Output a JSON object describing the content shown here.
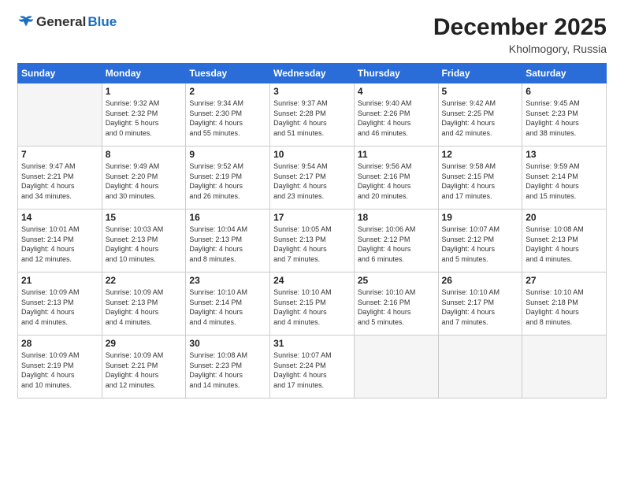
{
  "logo": {
    "general": "General",
    "blue": "Blue"
  },
  "header": {
    "month": "December 2025",
    "location": "Kholmogory, Russia"
  },
  "weekdays": [
    "Sunday",
    "Monday",
    "Tuesday",
    "Wednesday",
    "Thursday",
    "Friday",
    "Saturday"
  ],
  "weeks": [
    [
      {
        "day": "",
        "info": ""
      },
      {
        "day": "1",
        "info": "Sunrise: 9:32 AM\nSunset: 2:32 PM\nDaylight: 5 hours\nand 0 minutes."
      },
      {
        "day": "2",
        "info": "Sunrise: 9:34 AM\nSunset: 2:30 PM\nDaylight: 4 hours\nand 55 minutes."
      },
      {
        "day": "3",
        "info": "Sunrise: 9:37 AM\nSunset: 2:28 PM\nDaylight: 4 hours\nand 51 minutes."
      },
      {
        "day": "4",
        "info": "Sunrise: 9:40 AM\nSunset: 2:26 PM\nDaylight: 4 hours\nand 46 minutes."
      },
      {
        "day": "5",
        "info": "Sunrise: 9:42 AM\nSunset: 2:25 PM\nDaylight: 4 hours\nand 42 minutes."
      },
      {
        "day": "6",
        "info": "Sunrise: 9:45 AM\nSunset: 2:23 PM\nDaylight: 4 hours\nand 38 minutes."
      }
    ],
    [
      {
        "day": "7",
        "info": "Sunrise: 9:47 AM\nSunset: 2:21 PM\nDaylight: 4 hours\nand 34 minutes."
      },
      {
        "day": "8",
        "info": "Sunrise: 9:49 AM\nSunset: 2:20 PM\nDaylight: 4 hours\nand 30 minutes."
      },
      {
        "day": "9",
        "info": "Sunrise: 9:52 AM\nSunset: 2:19 PM\nDaylight: 4 hours\nand 26 minutes."
      },
      {
        "day": "10",
        "info": "Sunrise: 9:54 AM\nSunset: 2:17 PM\nDaylight: 4 hours\nand 23 minutes."
      },
      {
        "day": "11",
        "info": "Sunrise: 9:56 AM\nSunset: 2:16 PM\nDaylight: 4 hours\nand 20 minutes."
      },
      {
        "day": "12",
        "info": "Sunrise: 9:58 AM\nSunset: 2:15 PM\nDaylight: 4 hours\nand 17 minutes."
      },
      {
        "day": "13",
        "info": "Sunrise: 9:59 AM\nSunset: 2:14 PM\nDaylight: 4 hours\nand 15 minutes."
      }
    ],
    [
      {
        "day": "14",
        "info": "Sunrise: 10:01 AM\nSunset: 2:14 PM\nDaylight: 4 hours\nand 12 minutes."
      },
      {
        "day": "15",
        "info": "Sunrise: 10:03 AM\nSunset: 2:13 PM\nDaylight: 4 hours\nand 10 minutes."
      },
      {
        "day": "16",
        "info": "Sunrise: 10:04 AM\nSunset: 2:13 PM\nDaylight: 4 hours\nand 8 minutes."
      },
      {
        "day": "17",
        "info": "Sunrise: 10:05 AM\nSunset: 2:13 PM\nDaylight: 4 hours\nand 7 minutes."
      },
      {
        "day": "18",
        "info": "Sunrise: 10:06 AM\nSunset: 2:12 PM\nDaylight: 4 hours\nand 6 minutes."
      },
      {
        "day": "19",
        "info": "Sunrise: 10:07 AM\nSunset: 2:12 PM\nDaylight: 4 hours\nand 5 minutes."
      },
      {
        "day": "20",
        "info": "Sunrise: 10:08 AM\nSunset: 2:13 PM\nDaylight: 4 hours\nand 4 minutes."
      }
    ],
    [
      {
        "day": "21",
        "info": "Sunrise: 10:09 AM\nSunset: 2:13 PM\nDaylight: 4 hours\nand 4 minutes."
      },
      {
        "day": "22",
        "info": "Sunrise: 10:09 AM\nSunset: 2:13 PM\nDaylight: 4 hours\nand 4 minutes."
      },
      {
        "day": "23",
        "info": "Sunrise: 10:10 AM\nSunset: 2:14 PM\nDaylight: 4 hours\nand 4 minutes."
      },
      {
        "day": "24",
        "info": "Sunrise: 10:10 AM\nSunset: 2:15 PM\nDaylight: 4 hours\nand 4 minutes."
      },
      {
        "day": "25",
        "info": "Sunrise: 10:10 AM\nSunset: 2:16 PM\nDaylight: 4 hours\nand 5 minutes."
      },
      {
        "day": "26",
        "info": "Sunrise: 10:10 AM\nSunset: 2:17 PM\nDaylight: 4 hours\nand 7 minutes."
      },
      {
        "day": "27",
        "info": "Sunrise: 10:10 AM\nSunset: 2:18 PM\nDaylight: 4 hours\nand 8 minutes."
      }
    ],
    [
      {
        "day": "28",
        "info": "Sunrise: 10:09 AM\nSunset: 2:19 PM\nDaylight: 4 hours\nand 10 minutes."
      },
      {
        "day": "29",
        "info": "Sunrise: 10:09 AM\nSunset: 2:21 PM\nDaylight: 4 hours\nand 12 minutes."
      },
      {
        "day": "30",
        "info": "Sunrise: 10:08 AM\nSunset: 2:23 PM\nDaylight: 4 hours\nand 14 minutes."
      },
      {
        "day": "31",
        "info": "Sunrise: 10:07 AM\nSunset: 2:24 PM\nDaylight: 4 hours\nand 17 minutes."
      },
      {
        "day": "",
        "info": ""
      },
      {
        "day": "",
        "info": ""
      },
      {
        "day": "",
        "info": ""
      }
    ]
  ]
}
